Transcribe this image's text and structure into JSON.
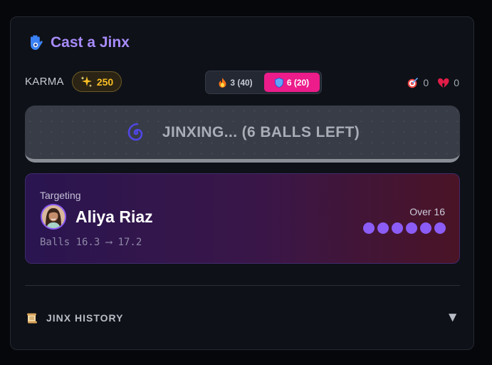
{
  "header": {
    "title": "Cast a Jinx",
    "icon": "hamsa-icon"
  },
  "karma": {
    "label": "KARMA",
    "icon": "sparkles-icon",
    "value": "250"
  },
  "mode_toggle": {
    "options": [
      {
        "icon": "fire-icon",
        "label": "3 (40)",
        "selected": false
      },
      {
        "icon": "shield-icon",
        "label": "6 (20)",
        "selected": true
      }
    ]
  },
  "stats": [
    {
      "icon": "target-hit-icon",
      "value": "0"
    },
    {
      "icon": "broken-heart-icon",
      "value": "0"
    }
  ],
  "jinx_button": {
    "icon": "swirl-icon",
    "label": "JINXING... (6 BALLS LEFT)"
  },
  "target": {
    "label": "Targeting",
    "player_name": "Aliya Riaz",
    "balls_range": "Balls 16.3 ⟶ 17.2",
    "over_label": "Over 16",
    "ball_dots": 6
  },
  "history": {
    "icon": "scroll-icon",
    "label": "JINX HISTORY",
    "expand_icon": "caret-down-icon"
  },
  "colors": {
    "accent_purple": "#a78bfa",
    "pink": "#ec1c8a",
    "gold": "#fbbf24",
    "dot": "#8b5cf6"
  }
}
